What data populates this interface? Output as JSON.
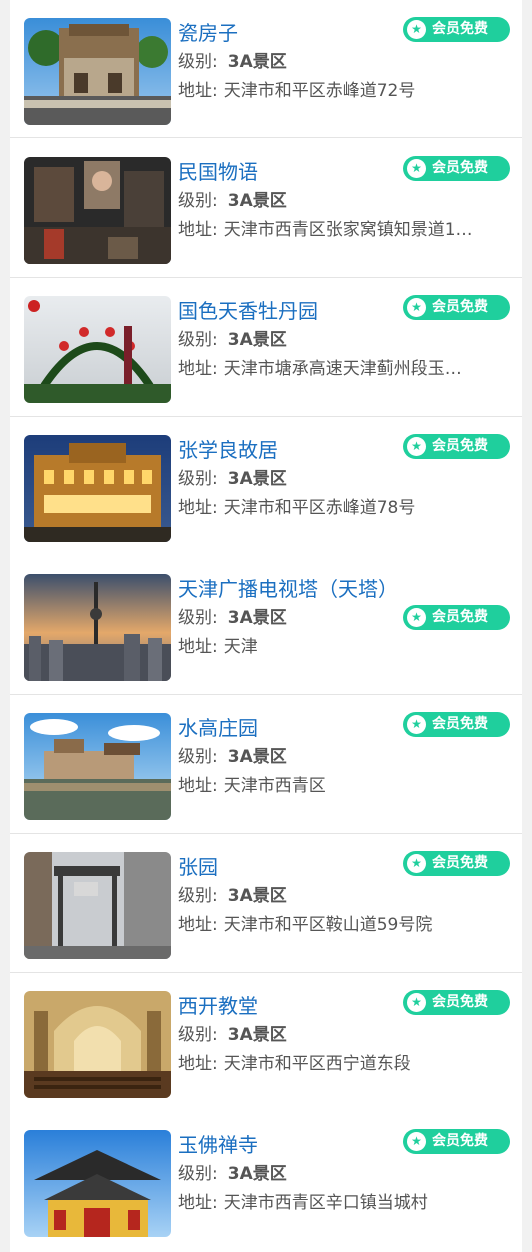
{
  "labels": {
    "level": "级别:",
    "address": "地址:"
  },
  "badge_text": "会员免费",
  "items": [
    {
      "name": "瓷房子",
      "level": "3A景区",
      "address": "天津市和平区赤峰道72号"
    },
    {
      "name": "民国物语",
      "level": "3A景区",
      "address": "天津市西青区张家窝镇知景道1…"
    },
    {
      "name": "国色天香牡丹园",
      "level": "3A景区",
      "address": "天津市塘承高速天津蓟州段玉…"
    },
    {
      "name": "张学良故居",
      "level": "3A景区",
      "address": "天津市和平区赤峰道78号"
    },
    {
      "name": "天津广播电视塔（天塔）",
      "level": "3A景区",
      "address": "天津"
    },
    {
      "name": "水高庄园",
      "level": "3A景区",
      "address": "天津市西青区"
    },
    {
      "name": "张园",
      "level": "3A景区",
      "address": "天津市和平区鞍山道59号院"
    },
    {
      "name": "西开教堂",
      "level": "3A景区",
      "address": "天津市和平区西宁道东段"
    },
    {
      "name": "玉佛禅寺",
      "level": "3A景区",
      "address": "天津市西青区辛口镇当城村"
    }
  ],
  "colors": {
    "title": "#1b6fc0",
    "badge": "#1fcf9d",
    "divider": "#e4e4e4"
  },
  "icons": {
    "badge_icon": "star-icon"
  }
}
